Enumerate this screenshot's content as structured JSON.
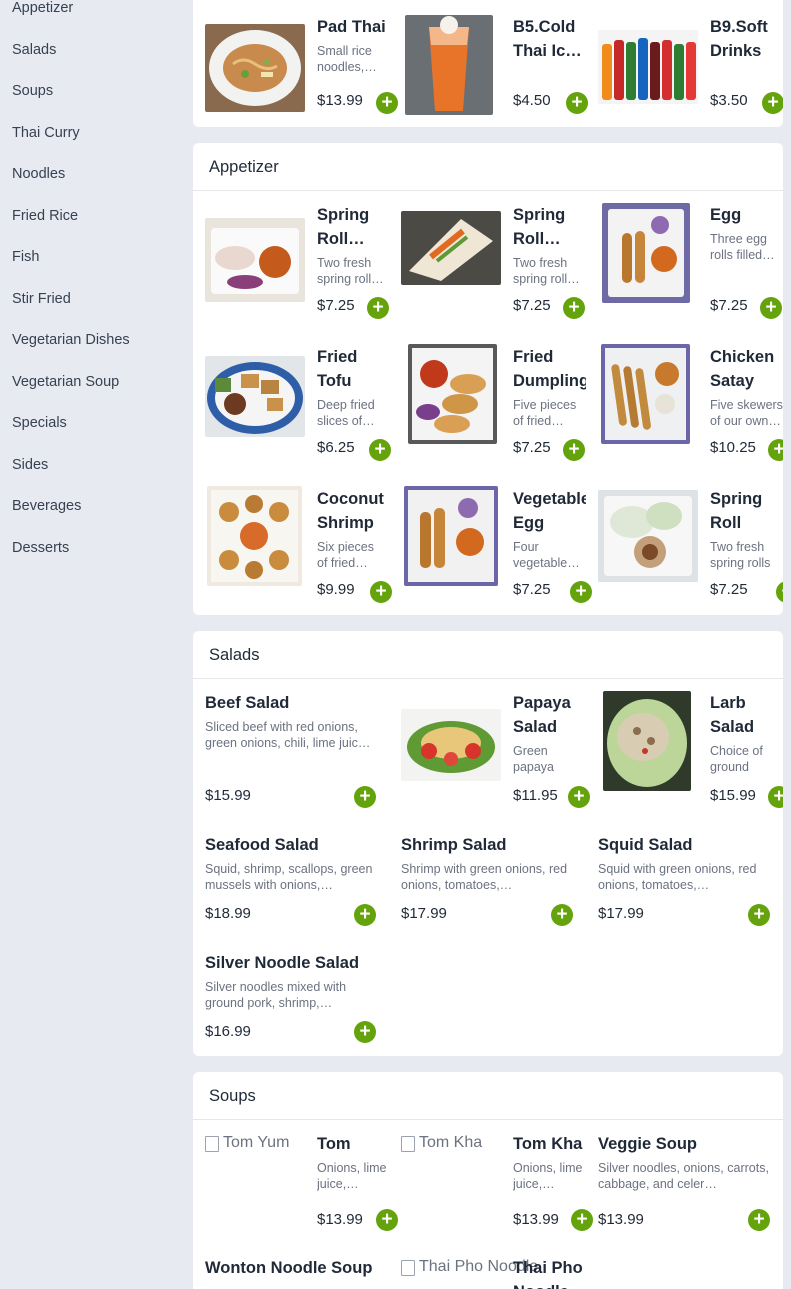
{
  "sidebar": {
    "items": [
      {
        "label": "Appetizer"
      },
      {
        "label": "Salads"
      },
      {
        "label": "Soups"
      },
      {
        "label": "Thai Curry"
      },
      {
        "label": "Noodles"
      },
      {
        "label": "Fried Rice"
      },
      {
        "label": "Fish"
      },
      {
        "label": "Stir Fried"
      },
      {
        "label": "Vegetarian Dishes"
      },
      {
        "label": "Vegetarian Soup"
      },
      {
        "label": "Specials"
      },
      {
        "label": "Sides"
      },
      {
        "label": "Beverages"
      },
      {
        "label": "Desserts"
      }
    ]
  },
  "add_label": "+",
  "sections": {
    "top": {
      "items": [
        {
          "name": "Pad Thai",
          "desc": "Small rice noodles,…",
          "price": "$13.99",
          "image": "pad-thai-photo"
        },
        {
          "name": "B5.Cold Thai Ic…",
          "desc": "",
          "price": "$4.50",
          "image": "thai-iced-tea-photo"
        },
        {
          "name": "B9.Soft Drinks",
          "desc": "",
          "price": "$3.50",
          "image": "soft-drinks-photo"
        }
      ]
    },
    "appetizer": {
      "title": "Appetizer",
      "items": [
        {
          "name": "Spring Roll…",
          "desc": "Two fresh spring roll…",
          "price": "$7.25",
          "image": "spring-roll-photo"
        },
        {
          "name": "Spring Roll…",
          "desc": "Two fresh spring roll…",
          "price": "$7.25",
          "image": "spring-roll-wrap-photo"
        },
        {
          "name": "Egg Rolls",
          "desc": "Three egg rolls filled…",
          "price": "$7.25",
          "image": "egg-rolls-photo"
        },
        {
          "name": "Fried Tofu",
          "desc": "Deep fried slices of…",
          "price": "$6.25",
          "image": "fried-tofu-photo"
        },
        {
          "name": "Fried Dumpling",
          "desc": "Five pieces of fried…",
          "price": "$7.25",
          "image": "fried-dumpling-photo"
        },
        {
          "name": "Chicken Satay",
          "desc": "Five skewers of our own…",
          "price": "$10.25",
          "image": "chicken-satay-photo"
        },
        {
          "name": "Coconut Shrimp",
          "desc": "Six pieces of fried…",
          "price": "$9.99",
          "image": "coconut-shrimp-photo"
        },
        {
          "name": "Vegetable Egg Rolls",
          "desc": "Four vegetable…",
          "price": "$7.25",
          "image": "vegetable-egg-rolls-photo"
        },
        {
          "name": "Spring Roll (Vegetarian)",
          "desc": "Two fresh spring rolls filled with…",
          "price": "$7.25",
          "image": "spring-roll-veg-photo"
        }
      ]
    },
    "salads": {
      "title": "Salads",
      "items": [
        {
          "name": "Beef Salad",
          "desc": "Sliced beef with red onions, green onions, chili, lime juic…",
          "price": "$15.99"
        },
        {
          "name": "Papaya Salad",
          "desc": "Green papaya wit…",
          "price": "$11.95",
          "image": "papaya-salad-photo"
        },
        {
          "name": "Larb Salad",
          "desc": "Choice of ground bee…",
          "price": "$15.99",
          "image": "larb-salad-photo"
        },
        {
          "name": "Seafood Salad",
          "desc": "Squid, shrimp, scallops, green mussels with onions,…",
          "price": "$18.99"
        },
        {
          "name": "Shrimp Salad",
          "desc": "Shrimp with green onions, red onions, tomatoes,…",
          "price": "$17.99"
        },
        {
          "name": "Squid Salad",
          "desc": "Squid with green onions, red onions, tomatoes,…",
          "price": "$17.99"
        },
        {
          "name": "Silver Noodle Salad",
          "desc": "Silver noodles mixed with ground pork, shrimp,…",
          "price": "$16.99"
        }
      ]
    },
    "soups": {
      "title": "Soups",
      "items": [
        {
          "name": "Tom Yum",
          "alt": "Tom Yum",
          "desc": "Onions, lime juice,…",
          "price": "$13.99"
        },
        {
          "name": "Tom Kha",
          "alt": "Tom Kha",
          "desc": "Onions, lime juice,…",
          "price": "$13.99"
        },
        {
          "name": "Veggie Soup",
          "desc": "Silver noodles, onions, carrots, cabbage, and celer…",
          "price": "$13.99"
        },
        {
          "name": "Wonton Noodle Soup",
          "desc": "",
          "price": ""
        },
        {
          "name": "Thai Pho Noodle…",
          "alt": "Thai Pho Noodle",
          "desc": "",
          "price": ""
        }
      ]
    }
  },
  "colors": {
    "page_bg": "#e7ebf1",
    "card_bg": "#ffffff",
    "accent_green": "#65a30d",
    "text_dark": "#1f2937",
    "text_muted": "#6b7280"
  }
}
